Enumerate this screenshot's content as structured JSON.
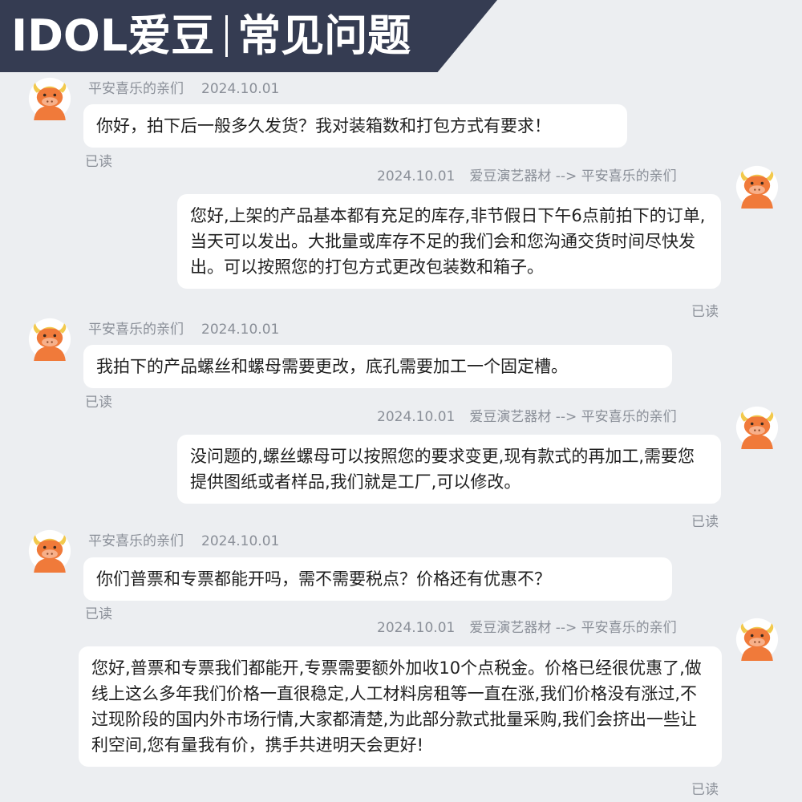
{
  "header": {
    "brand": "IDOL爱豆",
    "title": "常见问题"
  },
  "messages": [
    {
      "sender": "平安喜乐的亲们",
      "date": "2024.10.01",
      "text": "你好，拍下后一般多久发货？我对装箱数和打包方式有要求！",
      "read": "已读"
    },
    {
      "date": "2024.10.01",
      "route": "爱豆演艺器材 --> 平安喜乐的亲们",
      "text": "您好,上架的产品基本都有充足的库存,非节假日下午6点前拍下的订单,当天可以发出。大批量或库存不足的我们会和您沟通交货时间尽快发出。可以按照您的打包方式更改包装数和箱子。",
      "read": "已读"
    },
    {
      "sender": "平安喜乐的亲们",
      "date": "2024.10.01",
      "text": "我拍下的产品螺丝和螺母需要更改，底孔需要加工一个固定槽。",
      "read": "已读"
    },
    {
      "date": "2024.10.01",
      "route": "爱豆演艺器材 --> 平安喜乐的亲们",
      "text": "没问题的,螺丝螺母可以按照您的要求变更,现有款式的再加工,需要您提供图纸或者样品,我们就是工厂,可以修改。",
      "read": "已读"
    },
    {
      "sender": "平安喜乐的亲们",
      "date": "2024.10.01",
      "text": "你们普票和专票都能开吗，需不需要税点？价格还有优惠不？",
      "read": "已读"
    },
    {
      "date": "2024.10.01",
      "route": "爱豆演艺器材 --> 平安喜乐的亲们",
      "text": "您好,普票和专票我们都能开,专票需要额外加收10个点税金。价格已经很优惠了,做线上这么多年我们价格一直很稳定,人工材料房租等一直在涨,我们价格没有涨过,不过现阶段的国内外市场行情,大家都清楚,为此部分款式批量采购,我们会挤出一些让利空间,您有量我有价，携手共进明天会更好!",
      "read": "已读"
    }
  ],
  "colors": {
    "header_bg": "#353c52",
    "page_bg": "#eceef1",
    "bubble_bg": "#ffffff",
    "avatar_orange": "#f07a3a"
  },
  "icons": {
    "avatar": "cartoon-bull-avatar-icon"
  }
}
